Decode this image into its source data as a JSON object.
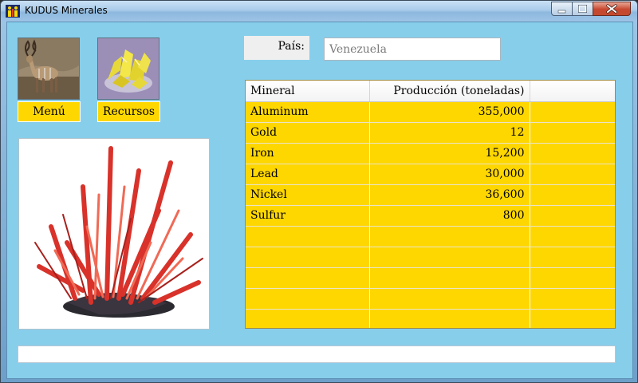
{
  "window": {
    "title": "KUDUS Minerales",
    "controls": {
      "minimize": "minimize-icon",
      "maximize": "maximize-icon",
      "close": "close-icon"
    }
  },
  "nav": {
    "menu_label": "Menú",
    "resources_label": "Recursos"
  },
  "country": {
    "label": "País:",
    "value": "Venezuela"
  },
  "table": {
    "headers": [
      "Mineral",
      "Producción (toneladas)",
      ""
    ],
    "rows": [
      {
        "mineral": "Aluminum",
        "production": "355,000"
      },
      {
        "mineral": "Gold",
        "production": "12"
      },
      {
        "mineral": "Iron",
        "production": "15,200"
      },
      {
        "mineral": "Lead",
        "production": "30,000"
      },
      {
        "mineral": "Nickel",
        "production": "36,600"
      },
      {
        "mineral": "Sulfur",
        "production": "800"
      },
      {
        "mineral": "",
        "production": ""
      },
      {
        "mineral": "",
        "production": ""
      },
      {
        "mineral": "",
        "production": ""
      },
      {
        "mineral": "",
        "production": ""
      },
      {
        "mineral": "",
        "production": ""
      }
    ]
  },
  "colors": {
    "client_bg": "#87ceeb",
    "accent_yellow": "#ffd700"
  }
}
